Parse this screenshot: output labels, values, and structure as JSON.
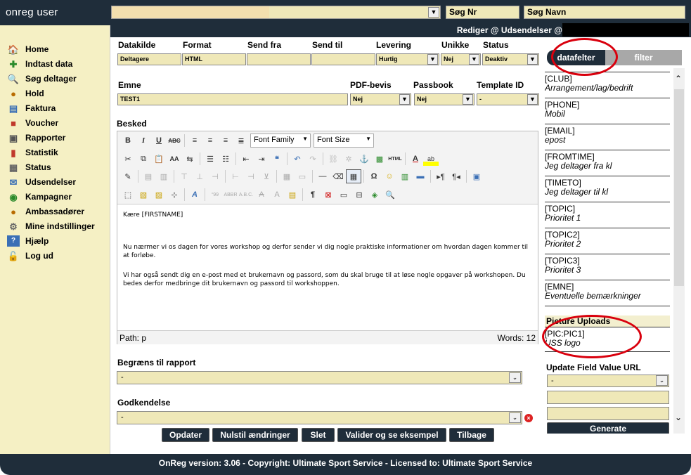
{
  "app": {
    "brand": "onreg user"
  },
  "top": {
    "search_nr": "Søg Nr",
    "search_name": "Søg Navn"
  },
  "header": {
    "title": "Rediger @ Udsendelser @"
  },
  "sidebar": {
    "items": [
      {
        "label": "Home",
        "icon": "home-icon"
      },
      {
        "label": "Indtast data",
        "icon": "add-user-icon"
      },
      {
        "label": "Søg deltager",
        "icon": "search-icon"
      },
      {
        "label": "Hold",
        "icon": "team-icon"
      },
      {
        "label": "Faktura",
        "icon": "invoice-icon"
      },
      {
        "label": "Voucher",
        "icon": "gift-icon"
      },
      {
        "label": "Rapporter",
        "icon": "report-icon"
      },
      {
        "label": "Statistik",
        "icon": "bar-chart-icon"
      },
      {
        "label": "Status",
        "icon": "status-icon"
      },
      {
        "label": "Udsendelser",
        "icon": "send-icon"
      },
      {
        "label": "Kampagner",
        "icon": "globe-icon"
      },
      {
        "label": "Ambassadører",
        "icon": "people-icon"
      },
      {
        "label": "Mine indstillinger",
        "icon": "settings-icon"
      },
      {
        "label": "Hjælp",
        "icon": "help-icon"
      },
      {
        "label": "Log ud",
        "icon": "lock-icon"
      }
    ]
  },
  "form": {
    "datakilde": {
      "label": "Datakilde",
      "value": "Deltagere"
    },
    "format": {
      "label": "Format",
      "value": "HTML"
    },
    "send_fra": {
      "label": "Send fra",
      "value": ""
    },
    "send_til": {
      "label": "Send til",
      "value": ""
    },
    "levering": {
      "label": "Levering",
      "value": "Hurtig"
    },
    "unikke": {
      "label": "Unikke",
      "value": "Nej"
    },
    "status": {
      "label": "Status",
      "value": "Deaktiv"
    },
    "emne": {
      "label": "Emne",
      "value": "TEST1"
    },
    "pdf_bevis": {
      "label": "PDF-bevis",
      "value": "Nej"
    },
    "passbook": {
      "label": "Passbook",
      "value": "Nej"
    },
    "template_id": {
      "label": "Template ID",
      "value": "-"
    },
    "besked": {
      "label": "Besked"
    }
  },
  "editor": {
    "font_family": "Font Family",
    "font_size": "Font Size",
    "paragraphs": [
      "Kære [FIRSTNAME]",
      "Nu nærmer vi os dagen for vores workshop og derfor sender vi dig nogle praktiske informationer om hvordan dagen kommer til at forløbe.",
      "Vi har også sendt dig en e-post med et brukernavn og passord, som du skal bruge til at løse nogle opgaver på workshopen. Du bedes derfor medbringe dit brukernavn og passord til workshoppen."
    ],
    "path": "Path: p",
    "words": "Words: 12"
  },
  "limit": {
    "label": "Begræns til rapport",
    "value": "-"
  },
  "approval": {
    "label": "Godkendelse",
    "value": "-"
  },
  "buttons": {
    "update": "Opdater",
    "reset": "Nulstil ændringer",
    "delete": "Slet",
    "validate": "Valider og se eksempel",
    "back": "Tilbage"
  },
  "panel": {
    "tab_active": "datafelter",
    "tab_inactive": "filter",
    "fields": [
      {
        "code": "[CLUB]",
        "desc": "Arrangement/lag/bedrift"
      },
      {
        "code": "[PHONE]",
        "desc": "Mobil"
      },
      {
        "code": "[EMAIL]",
        "desc": "epost"
      },
      {
        "code": "[FROMTIME]",
        "desc": "Jeg deltager fra kl"
      },
      {
        "code": "[TIMETO]",
        "desc": "Jeg deltager til kl"
      },
      {
        "code": "[TOPIC]",
        "desc": "Prioritet 1"
      },
      {
        "code": "[TOPIC2]",
        "desc": "Prioritet 2"
      },
      {
        "code": "[TOPIC3]",
        "desc": "Prioritet 3"
      },
      {
        "code": "[EMNE]",
        "desc": "Eventuelle bemærkninger"
      }
    ],
    "picture_section": "Picture Uploads",
    "pic": {
      "code": "[PIC:PIC1]",
      "desc": "USS logo"
    },
    "update_section": "Update Field Value URL",
    "update_select": "-",
    "generate": "Generate"
  },
  "footer": {
    "text": "OnReg version: 3.06 - Copyright: Ultimate Sport Service - Licensed to: Ultimate Sport Service"
  },
  "colors": {
    "dark": "#1f2d3a",
    "field_bg": "#efe8b8",
    "sidebar_bg": "#f5f0c4",
    "highlight_ring": "#d9000d"
  }
}
